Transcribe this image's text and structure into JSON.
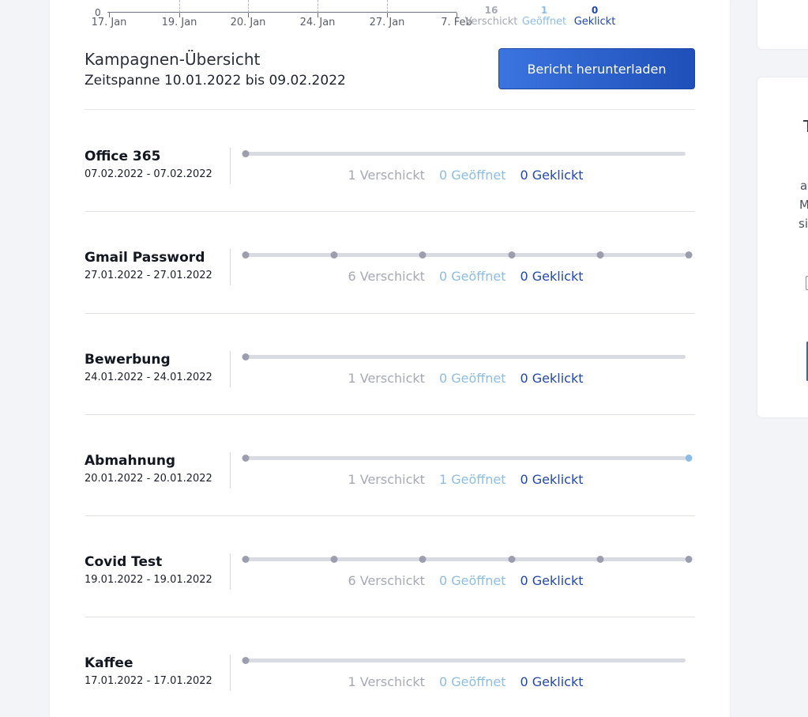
{
  "colors": {
    "sent": "#a6a9b4",
    "opened": "#8dbde4",
    "clicked": "#1f47b2",
    "button": "#2e62d6",
    "track": "#d9dbe2",
    "dot": "#9c9ead",
    "dot_opened": "#8dbde4"
  },
  "top_chart": {
    "y_zero_label": "0",
    "x_labels": [
      "17. Jan",
      "19. Jan",
      "20. Jan",
      "24. Jan",
      "27. Jan",
      "7. Feb"
    ],
    "totals": [
      {
        "value": "16",
        "label": "Verschickt"
      },
      {
        "value": "1",
        "label": "Geöffnet"
      },
      {
        "value": "0",
        "label": "Geklickt"
      }
    ]
  },
  "overview": {
    "title": "Kampagnen-Übersicht",
    "period": "Zeitspanne 10.01.2022 bis 09.02.2022",
    "download_label": "Bericht herunterladen"
  },
  "campaigns": [
    {
      "name": "Office 365",
      "dates": "07.02.2022 - 07.02.2022",
      "dots": 1,
      "opened_dots": 0,
      "sent": "1 Verschickt",
      "opened": "0 Geöffnet",
      "clicked": "0 Geklickt"
    },
    {
      "name": "Gmail Password",
      "dates": "27.01.2022 - 27.01.2022",
      "dots": 6,
      "opened_dots": 0,
      "sent": "6 Verschickt",
      "opened": "0 Geöffnet",
      "clicked": "0 Geklickt"
    },
    {
      "name": "Bewerbung",
      "dates": "24.01.2022 - 24.01.2022",
      "dots": 1,
      "opened_dots": 0,
      "sent": "1 Verschickt",
      "opened": "0 Geöffnet",
      "clicked": "0 Geklickt"
    },
    {
      "name": "Abmahnung",
      "dates": "20.01.2022 - 20.01.2022",
      "dots": 1,
      "opened_dots": 1,
      "sent": "1 Verschickt",
      "opened": "1 Geöffnet",
      "clicked": "0 Geklickt"
    },
    {
      "name": "Covid Test",
      "dates": "19.01.2022 - 19.01.2022",
      "dots": 6,
      "opened_dots": 0,
      "sent": "6 Verschickt",
      "opened": "0 Geöffnet",
      "clicked": "0 Geklickt"
    },
    {
      "name": "Kaffee",
      "dates": "17.01.2022 - 17.01.2022",
      "dots": 1,
      "opened_dots": 0,
      "sent": "1 Verschickt",
      "opened": "0 Geöffnet",
      "clicked": "0 Geklickt"
    }
  ],
  "side_panel": {
    "fragments": [
      "T",
      "a",
      "M",
      "si"
    ]
  }
}
